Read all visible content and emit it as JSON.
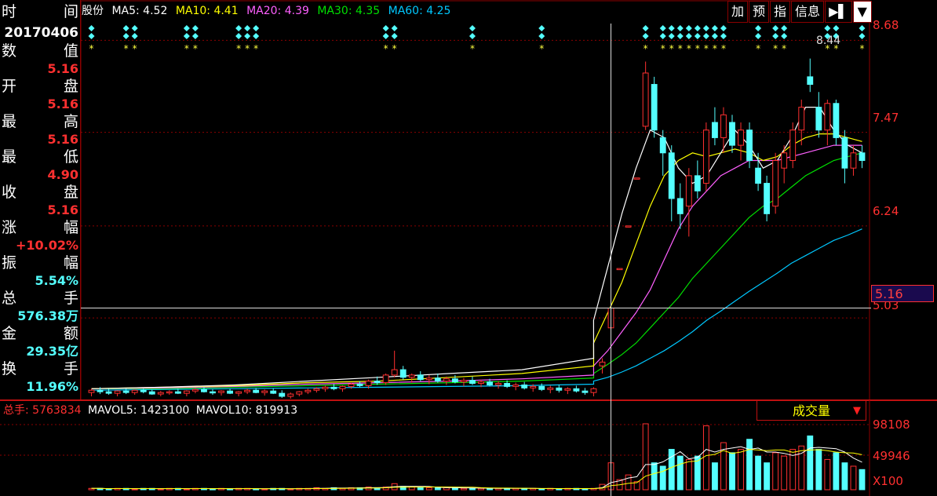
{
  "info_panel": {
    "time_label": [
      "时",
      "间"
    ],
    "date": "20170406",
    "value_label": [
      "数",
      "值"
    ],
    "value": "5.16",
    "open_label": [
      "开",
      "盘"
    ],
    "open": "5.16",
    "high_label": [
      "最",
      "高"
    ],
    "high": "5.16",
    "low_label": [
      "最",
      "低"
    ],
    "low": "4.90",
    "close_label": [
      "收",
      "盘"
    ],
    "close": "5.16",
    "change_label": [
      "涨",
      "幅"
    ],
    "change": "+10.02%",
    "amplitude_label": [
      "振",
      "幅"
    ],
    "amplitude": "5.54%",
    "volume_label": [
      "总",
      "手"
    ],
    "volume": "576.38万",
    "amount_label": [
      "金",
      "额"
    ],
    "amount": "29.35亿",
    "turnover_label": [
      "换",
      "手"
    ],
    "turnover": "11.96%"
  },
  "ma_header": {
    "name_fragment": "股份",
    "ma5": "MA5: 4.52",
    "ma10": "MA10: 4.41",
    "ma20": "MA20: 4.39",
    "ma30": "MA30: 4.35",
    "ma60": "MA60: 4.25"
  },
  "toolbar": {
    "add": "加",
    "forecast": "预",
    "index": "指",
    "info": "信息",
    "jump": "▶▌",
    "dropdown": "▼"
  },
  "price_axis": [
    "8.68",
    "7.47",
    "6.24",
    "5.03"
  ],
  "current_price": "5.16",
  "peak_label": "8.44",
  "vol_header": {
    "total": "总手: 5763834",
    "mavol5": "MAVOL5: 1423100",
    "mavol10": "MAVOL10: 819913"
  },
  "vol_selector": {
    "label": "成交量",
    "arrow": "▼"
  },
  "vol_axis": [
    "98108",
    "49946",
    "X100"
  ],
  "colors": {
    "up": "#ff3030",
    "down": "#54ffff",
    "ma5": "#ffffff",
    "ma10": "#ffff00",
    "ma20": "#ff60ff",
    "ma30": "#00e000",
    "ma60": "#00c8ff",
    "grid": "#8b0000"
  },
  "chart_data": {
    "type": "candlestick",
    "price_range": [
      4.0,
      8.9
    ],
    "candles": [
      [
        4.05,
        4.1,
        4.0,
        4.08
      ],
      [
        4.08,
        4.12,
        4.03,
        4.06
      ],
      [
        4.06,
        4.1,
        4.02,
        4.04
      ],
      [
        4.04,
        4.08,
        4.0,
        4.07
      ],
      [
        4.07,
        4.1,
        4.03,
        4.05
      ],
      [
        4.05,
        4.09,
        4.02,
        4.08
      ],
      [
        4.08,
        4.1,
        4.04,
        4.06
      ],
      [
        4.06,
        4.09,
        4.02,
        4.03
      ],
      [
        4.03,
        4.07,
        4.0,
        4.05
      ],
      [
        4.05,
        4.08,
        4.02,
        4.06
      ],
      [
        4.06,
        4.1,
        4.03,
        4.04
      ],
      [
        4.04,
        4.08,
        4.0,
        4.07
      ],
      [
        4.07,
        4.11,
        4.04,
        4.09
      ],
      [
        4.09,
        4.12,
        4.05,
        4.06
      ],
      [
        4.06,
        4.09,
        4.02,
        4.05
      ],
      [
        4.05,
        4.08,
        4.01,
        4.07
      ],
      [
        4.07,
        4.1,
        4.03,
        4.04
      ],
      [
        4.04,
        4.07,
        4.0,
        4.06
      ],
      [
        4.06,
        4.1,
        4.03,
        4.08
      ],
      [
        4.08,
        4.11,
        4.04,
        4.05
      ],
      [
        4.05,
        4.09,
        4.01,
        4.07
      ],
      [
        4.07,
        4.1,
        4.03,
        4.04
      ],
      [
        4.04,
        4.08,
        3.98,
        4.0
      ],
      [
        4.0,
        4.05,
        3.97,
        4.03
      ],
      [
        4.03,
        4.07,
        4.0,
        4.06
      ],
      [
        4.06,
        4.1,
        4.03,
        4.08
      ],
      [
        4.08,
        4.12,
        4.05,
        4.1
      ],
      [
        4.1,
        4.14,
        4.06,
        4.12
      ],
      [
        4.12,
        4.16,
        4.08,
        4.1
      ],
      [
        4.1,
        4.14,
        4.06,
        4.13
      ],
      [
        4.13,
        4.18,
        4.1,
        4.16
      ],
      [
        4.16,
        4.2,
        4.12,
        4.14
      ],
      [
        4.14,
        4.22,
        4.1,
        4.2
      ],
      [
        4.2,
        4.26,
        4.15,
        4.18
      ],
      [
        4.18,
        4.3,
        4.15,
        4.28
      ],
      [
        4.28,
        4.6,
        4.25,
        4.35
      ],
      [
        4.35,
        4.4,
        4.22,
        4.25
      ],
      [
        4.25,
        4.3,
        4.18,
        4.28
      ],
      [
        4.28,
        4.33,
        4.2,
        4.22
      ],
      [
        4.22,
        4.28,
        4.16,
        4.24
      ],
      [
        4.24,
        4.3,
        4.18,
        4.2
      ],
      [
        4.2,
        4.26,
        4.15,
        4.23
      ],
      [
        4.23,
        4.28,
        4.17,
        4.19
      ],
      [
        4.19,
        4.24,
        4.13,
        4.21
      ],
      [
        4.21,
        4.26,
        4.15,
        4.17
      ],
      [
        4.17,
        4.22,
        4.12,
        4.19
      ],
      [
        4.19,
        4.23,
        4.13,
        4.15
      ],
      [
        4.15,
        4.2,
        4.1,
        4.17
      ],
      [
        4.17,
        4.21,
        4.11,
        4.13
      ],
      [
        4.13,
        4.18,
        4.08,
        4.15
      ],
      [
        4.15,
        4.19,
        4.09,
        4.11
      ],
      [
        4.11,
        4.16,
        4.06,
        4.13
      ],
      [
        4.13,
        4.17,
        4.07,
        4.09
      ],
      [
        4.09,
        4.14,
        4.04,
        4.11
      ],
      [
        4.11,
        4.15,
        4.05,
        4.08
      ],
      [
        4.08,
        4.12,
        4.03,
        4.1
      ],
      [
        4.1,
        4.14,
        4.05,
        4.07
      ],
      [
        4.07,
        4.11,
        4.02,
        4.05
      ],
      [
        4.05,
        4.12,
        4.0,
        4.1
      ],
      [
        4.4,
        4.5,
        4.3,
        4.45
      ],
      [
        4.9,
        5.16,
        4.9,
        5.16
      ],
      [
        5.68,
        5.68,
        5.68,
        5.68
      ],
      [
        6.24,
        6.24,
        6.24,
        6.24
      ],
      [
        6.87,
        6.87,
        6.87,
        6.87
      ],
      [
        7.55,
        8.4,
        7.5,
        8.25
      ],
      [
        8.1,
        8.2,
        7.4,
        7.5
      ],
      [
        7.4,
        7.5,
        6.9,
        7.2
      ],
      [
        7.2,
        7.3,
        6.3,
        6.6
      ],
      [
        6.6,
        6.8,
        6.2,
        6.4
      ],
      [
        6.5,
        7.0,
        6.1,
        6.9
      ],
      [
        6.9,
        7.1,
        6.6,
        6.7
      ],
      [
        6.8,
        7.6,
        6.7,
        7.5
      ],
      [
        7.6,
        7.8,
        7.3,
        7.4
      ],
      [
        7.4,
        7.8,
        7.2,
        7.7
      ],
      [
        7.6,
        7.7,
        7.2,
        7.3
      ],
      [
        7.3,
        7.6,
        7.1,
        7.5
      ],
      [
        7.5,
        7.6,
        7.0,
        7.1
      ],
      [
        7.0,
        7.2,
        6.7,
        6.8
      ],
      [
        6.8,
        6.9,
        6.3,
        6.4
      ],
      [
        6.5,
        7.2,
        6.4,
        7.1
      ],
      [
        7.0,
        7.3,
        6.8,
        7.2
      ],
      [
        7.1,
        7.6,
        7.0,
        7.5
      ],
      [
        7.5,
        7.9,
        7.3,
        7.8
      ],
      [
        8.2,
        8.44,
        8.0,
        8.1
      ],
      [
        7.8,
        8.0,
        7.4,
        7.5
      ],
      [
        7.5,
        7.9,
        7.3,
        7.85
      ],
      [
        7.85,
        7.9,
        7.3,
        7.4
      ],
      [
        7.4,
        7.5,
        6.8,
        7.0
      ],
      [
        7.0,
        7.3,
        6.9,
        7.2
      ],
      [
        7.2,
        7.3,
        7.0,
        7.1
      ]
    ],
    "volume": [
      2,
      2,
      1,
      2,
      2,
      1,
      2,
      2,
      1,
      2,
      2,
      1,
      2,
      2,
      1,
      2,
      1,
      2,
      2,
      1,
      1,
      2,
      2,
      1,
      2,
      2,
      3,
      2,
      3,
      2,
      3,
      3,
      4,
      3,
      4,
      9,
      5,
      4,
      3,
      3,
      3,
      3,
      3,
      2,
      2,
      2,
      2,
      2,
      2,
      2,
      2,
      2,
      1,
      2,
      1,
      2,
      2,
      1,
      2,
      8,
      40,
      15,
      22,
      12,
      98,
      40,
      35,
      60,
      50,
      45,
      50,
      95,
      40,
      70,
      55,
      60,
      75,
      50,
      40,
      55,
      50,
      60,
      65,
      80,
      60,
      45,
      55,
      40,
      35,
      30
    ],
    "ma5": [
      4.1,
      4.12,
      4.15,
      4.2,
      4.25,
      4.3,
      4.35,
      4.5,
      5.0,
      5.7,
      6.4,
      7.0,
      7.5,
      7.4,
      7.0,
      6.8,
      6.9,
      7.2,
      7.5,
      7.3,
      7.0,
      7.1,
      7.4,
      7.8,
      7.8,
      7.5,
      7.3,
      7.2
    ],
    "ma10": [
      4.1,
      4.12,
      4.14,
      4.18,
      4.2,
      4.25,
      4.3,
      4.4,
      4.7,
      5.1,
      5.5,
      6.0,
      6.5,
      6.9,
      7.1,
      7.2,
      7.15,
      7.2,
      7.25,
      7.2,
      7.1,
      7.15,
      7.3,
      7.4,
      7.45,
      7.45,
      7.4,
      7.35
    ],
    "ma20": [
      4.1,
      4.11,
      4.13,
      4.16,
      4.18,
      4.2,
      4.23,
      4.28,
      4.4,
      4.6,
      4.85,
      5.1,
      5.4,
      5.8,
      6.2,
      6.5,
      6.7,
      6.9,
      7.0,
      7.1,
      7.1,
      7.1,
      7.15,
      7.2,
      7.25,
      7.3,
      7.3,
      7.3
    ],
    "ma30": [
      4.1,
      4.1,
      4.12,
      4.14,
      4.16,
      4.18,
      4.2,
      4.24,
      4.3,
      4.42,
      4.55,
      4.7,
      4.9,
      5.1,
      5.3,
      5.55,
      5.75,
      5.95,
      6.15,
      6.35,
      6.5,
      6.6,
      6.75,
      6.9,
      7.0,
      7.1,
      7.15,
      7.2
    ],
    "ma60": [
      4.08,
      4.09,
      4.1,
      4.11,
      4.12,
      4.13,
      4.14,
      4.16,
      4.2,
      4.25,
      4.32,
      4.4,
      4.5,
      4.6,
      4.72,
      4.85,
      5.0,
      5.12,
      5.25,
      5.38,
      5.5,
      5.62,
      5.75,
      5.85,
      5.95,
      6.05,
      6.12,
      6.2
    ]
  }
}
